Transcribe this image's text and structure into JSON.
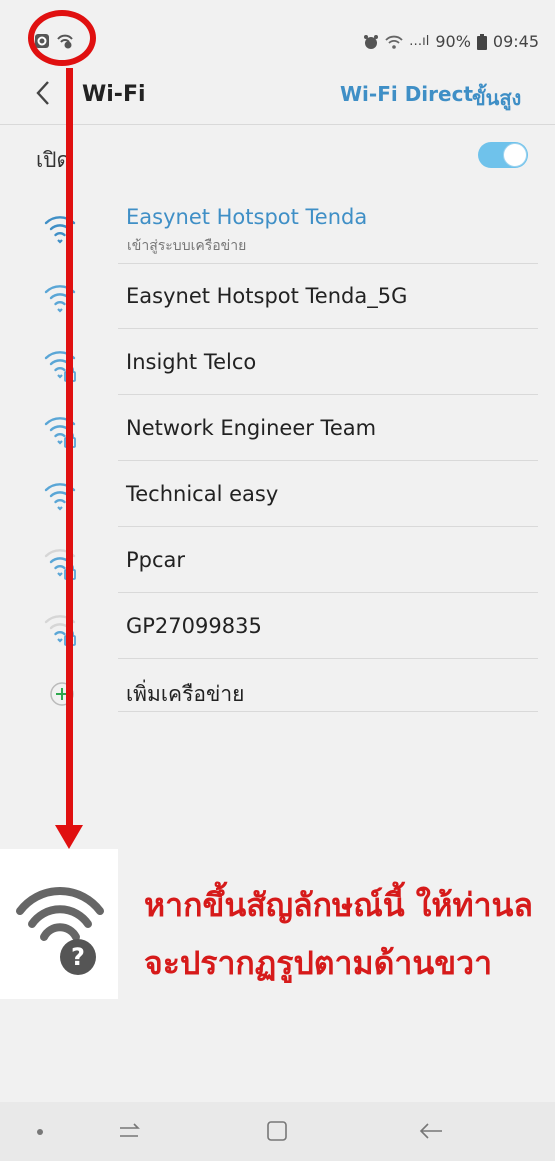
{
  "status": {
    "signal_label": "…ıl",
    "battery": "90%",
    "time": "09:45"
  },
  "header": {
    "title": "Wi-Fi",
    "wifi_direct": "Wi-Fi Direct",
    "advanced": "ขั้นสูง"
  },
  "toggle": {
    "label": "เปิด",
    "on": true
  },
  "networks": [
    {
      "name": "Easynet Hotspot Tenda",
      "sub": "เข้าสู่ระบบเครือข่าย",
      "connected": true,
      "locked": false,
      "strength": 3
    },
    {
      "name": "Easynet Hotspot Tenda_5G",
      "sub": "",
      "connected": false,
      "locked": false,
      "strength": 3
    },
    {
      "name": "Insight Telco",
      "sub": "",
      "connected": false,
      "locked": true,
      "strength": 3
    },
    {
      "name": "Network Engineer Team",
      "sub": "",
      "connected": false,
      "locked": true,
      "strength": 3
    },
    {
      "name": "Technical easy",
      "sub": "",
      "connected": false,
      "locked": false,
      "strength": 3
    },
    {
      "name": "Ppcar",
      "sub": "",
      "connected": false,
      "locked": true,
      "strength": 2
    },
    {
      "name": "GP27099835",
      "sub": "",
      "connected": false,
      "locked": true,
      "strength": 1
    }
  ],
  "add_network": "เพิ่มเครือข่าย",
  "annotation": {
    "line1": "หากขึ้นสัญลักษณ์นี้ ให้ท่านล",
    "line2": "จะปรากฏรูปตามด้านขวา"
  },
  "colors": {
    "accent": "#3f8fc6",
    "annotation": "#d61a1a"
  }
}
